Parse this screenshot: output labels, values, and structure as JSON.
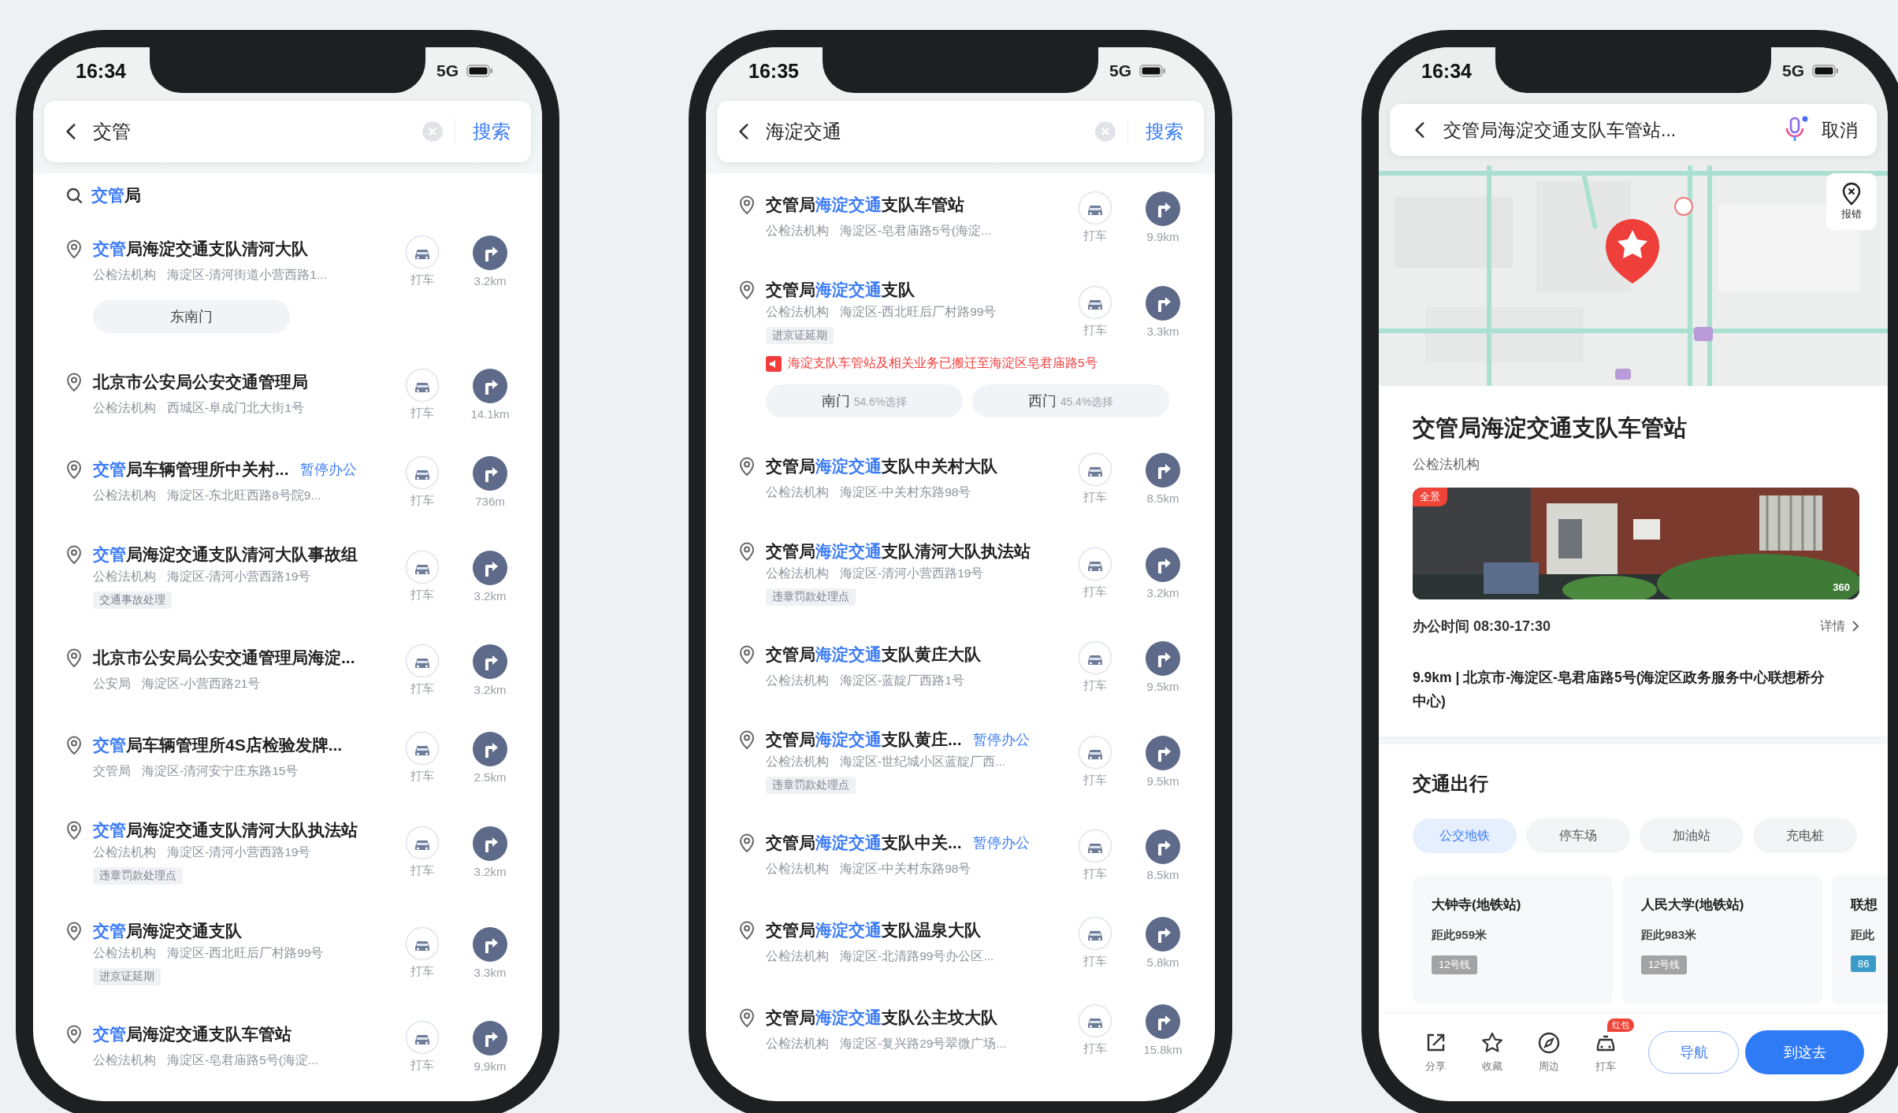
{
  "screens": [
    {
      "kind": "search",
      "status_time": "16:34",
      "network": "5G",
      "query": "交管",
      "search_button": "搜索",
      "suggestion": {
        "match": "交管",
        "after": "局"
      },
      "results": [
        {
          "match": "交管",
          "after": "局海淀交通支队清河大队",
          "category": "公检法机构",
          "address": "海淀区-清河街道小营西路1...",
          "taxi": "打车",
          "distance": "3.2km",
          "entrances": [
            {
              "name": "东南门"
            }
          ]
        },
        {
          "before": "北京市公安局公安交通管理局",
          "category": "公检法机构",
          "address": "西城区-阜成门北大街1号",
          "taxi": "打车",
          "distance": "14.1km"
        },
        {
          "match": "交管",
          "after": "局车辆管理所中关村...",
          "status": "暂停办公",
          "category": "公检法机构",
          "address": "海淀区-东北旺西路8号院9...",
          "taxi": "打车",
          "distance": "736m"
        },
        {
          "match": "交管",
          "after": "局海淀交通支队清河大队事故组",
          "category": "公检法机构",
          "address": "海淀区-清河小营西路19号",
          "tag": "交通事故处理",
          "taxi": "打车",
          "distance": "3.2km"
        },
        {
          "before": "北京市公安局公安交通管理局海淀...",
          "category": "公安局",
          "address": "海淀区-小营西路21号",
          "taxi": "打车",
          "distance": "3.2km"
        },
        {
          "match": "交管",
          "after": "局车辆管理所4S店检验发牌...",
          "category": "交管局",
          "address": "海淀区-清河安宁庄东路15号",
          "taxi": "打车",
          "distance": "2.5km"
        },
        {
          "match": "交管",
          "after": "局海淀交通支队清河大队执法站",
          "category": "公检法机构",
          "address": "海淀区-清河小营西路19号",
          "tag": "违章罚款处理点",
          "taxi": "打车",
          "distance": "3.2km"
        },
        {
          "match": "交管",
          "after": "局海淀交通支队",
          "category": "公检法机构",
          "address": "海淀区-西北旺后厂村路99号",
          "tag": "进京证延期",
          "taxi": "打车",
          "distance": "3.3km"
        },
        {
          "match": "交管",
          "after": "局海淀交通支队车管站",
          "category": "公检法机构",
          "address": "海淀区-皂君庙路5号(海淀...",
          "taxi": "打车",
          "distance": "9.9km"
        }
      ]
    },
    {
      "kind": "search",
      "status_time": "16:35",
      "network": "5G",
      "query": "海淀交通",
      "search_button": "搜索",
      "results": [
        {
          "before": "交管局",
          "match": "海淀交通",
          "after": "支队车管站",
          "category": "公检法机构",
          "address": "海淀区-皂君庙路5号(海淀...",
          "taxi": "打车",
          "distance": "9.9km"
        },
        {
          "before": "交管局",
          "match": "海淀交通",
          "after": "支队",
          "category": "公检法机构",
          "address": "海淀区-西北旺后厂村路99号",
          "tag": "进京证延期",
          "notice": "海淀支队车管站及相关业务已搬迁至海淀区皂君庙路5号",
          "entrances": [
            {
              "name": "南门",
              "share": "54.6%选择"
            },
            {
              "name": "西门",
              "share": "45.4%选择"
            }
          ],
          "taxi": "打车",
          "distance": "3.3km"
        },
        {
          "before": "交管局",
          "match": "海淀交通",
          "after": "支队中关村大队",
          "category": "公检法机构",
          "address": "海淀区-中关村东路98号",
          "taxi": "打车",
          "distance": "8.5km"
        },
        {
          "before": "交管局",
          "match": "海淀交通",
          "after": "支队清河大队执法站",
          "category": "公检法机构",
          "address": "海淀区-清河小营西路19号",
          "tag": "违章罚款处理点",
          "taxi": "打车",
          "distance": "3.2km"
        },
        {
          "before": "交管局",
          "match": "海淀交通",
          "after": "支队黄庄大队",
          "category": "公检法机构",
          "address": "海淀区-蓝靛厂西路1号",
          "taxi": "打车",
          "distance": "9.5km"
        },
        {
          "before": "交管局",
          "match": "海淀交通",
          "after": "支队黄庄...",
          "status": "暂停办公",
          "category": "公检法机构",
          "address": "海淀区-世纪城小区蓝靛厂西...",
          "tag": "违章罚款处理点",
          "taxi": "打车",
          "distance": "9.5km"
        },
        {
          "before": "交管局",
          "match": "海淀交通",
          "after": "支队中关...",
          "status": "暂停办公",
          "category": "公检法机构",
          "address": "海淀区-中关村东路98号",
          "taxi": "打车",
          "distance": "8.5km"
        },
        {
          "before": "交管局",
          "match": "海淀交通",
          "after": "支队温泉大队",
          "category": "公检法机构",
          "address": "海淀区-北清路99号办公区...",
          "taxi": "打车",
          "distance": "5.8km"
        },
        {
          "before": "交管局",
          "match": "海淀交通",
          "after": "支队公主坟大队",
          "category": "公检法机构",
          "address": "海淀区-复兴路29号翠微广场...",
          "taxi": "打车",
          "distance": "15.8km"
        }
      ]
    },
    {
      "kind": "detail",
      "status_time": "16:34",
      "network": "5G",
      "query": "交管局海淀交通支队车管站...",
      "cancel": "取消",
      "report": "报错",
      "place_name": "交管局海淀交通支队车管站",
      "category": "公检法机构",
      "photo": {
        "kind": "picture",
        "badge": "全景",
        "mark": "360"
      },
      "hours": "办公时间 08:30-17:30",
      "details": "详情",
      "address": "9.9km | 北京市-海淀区-皂君庙路5号(海淀区政务服务中心联想桥分中心)",
      "transit": {
        "heading": "交通出行",
        "chips": [
          {
            "label": "公交地铁",
            "selected": true
          },
          {
            "label": "停车场",
            "selected": false
          },
          {
            "label": "加油站",
            "selected": false
          },
          {
            "label": "充电桩",
            "selected": false
          }
        ],
        "stations": [
          {
            "name": "大钟寺(地铁站)",
            "distance": "距此959米",
            "line": "12号线",
            "color": "#a3a3a3"
          },
          {
            "name": "人民大学(地铁站)",
            "distance": "距此983米",
            "line": "12号线",
            "color": "#a3a3a3"
          },
          {
            "name": "联想",
            "distance": "距此",
            "line": "86",
            "color": "#3a9bc8"
          }
        ]
      },
      "actions": [
        {
          "kind": "share",
          "label": "分享"
        },
        {
          "kind": "favorite",
          "label": "收藏"
        },
        {
          "kind": "nearby",
          "label": "周边"
        },
        {
          "kind": "taxi",
          "label": "打车",
          "badge": "红包"
        }
      ],
      "navigate": "导航",
      "go": "到这去"
    }
  ]
}
